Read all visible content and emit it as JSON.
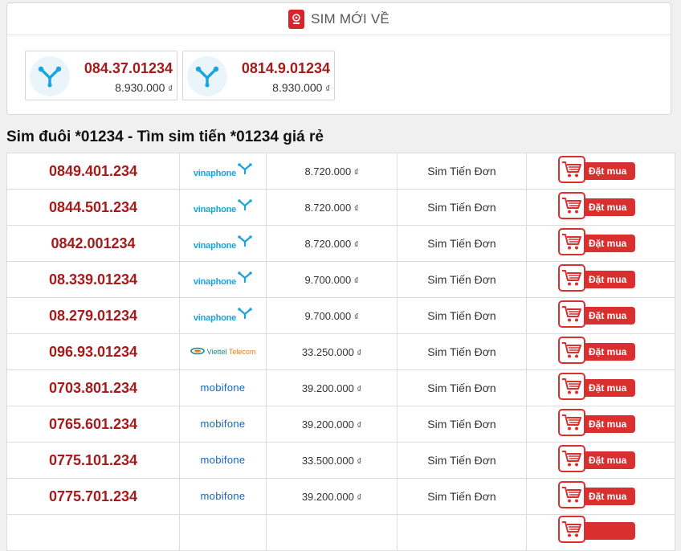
{
  "new_sims": {
    "title": "SIM MỚI VỀ",
    "cards": [
      {
        "number": "084.37.01234",
        "price": "8.930.000",
        "unit": "₫"
      },
      {
        "number": "0814.9.01234",
        "price": "8.930.000",
        "unit": "₫"
      }
    ]
  },
  "section_title": "Sim đuôi *01234 - Tìm sim tiến *01234 giá rẻ",
  "networks": {
    "vinaphone": "vinaphone",
    "viettel_a": "Viettel",
    "viettel_b": "Telecom",
    "mobifone": "mobifone"
  },
  "buy_label": "Đặt mua",
  "currency_unit": "₫",
  "rows": [
    {
      "number": "0849.401.234",
      "network": "vinaphone",
      "price": "8.720.000",
      "type": "Sim Tiến Đơn"
    },
    {
      "number": "0844.501.234",
      "network": "vinaphone",
      "price": "8.720.000",
      "type": "Sim Tiến Đơn"
    },
    {
      "number": "0842.001234",
      "network": "vinaphone",
      "price": "8.720.000",
      "type": "Sim Tiến Đơn"
    },
    {
      "number": "08.339.01234",
      "network": "vinaphone",
      "price": "9.700.000",
      "type": "Sim Tiến Đơn"
    },
    {
      "number": "08.279.01234",
      "network": "vinaphone",
      "price": "9.700.000",
      "type": "Sim Tiến Đơn"
    },
    {
      "number": "096.93.01234",
      "network": "viettel",
      "price": "33.250.000",
      "type": "Sim Tiến Đơn"
    },
    {
      "number": "0703.801.234",
      "network": "mobifone",
      "price": "39.200.000",
      "type": "Sim Tiến Đơn"
    },
    {
      "number": "0765.601.234",
      "network": "mobifone",
      "price": "39.200.000",
      "type": "Sim Tiến Đơn"
    },
    {
      "number": "0775.101.234",
      "network": "mobifone",
      "price": "33.500.000",
      "type": "Sim Tiến Đơn"
    },
    {
      "number": "0775.701.234",
      "network": "mobifone",
      "price": "39.200.000",
      "type": "Sim Tiến Đơn"
    }
  ],
  "colors": {
    "number_red": "#a51b1b",
    "button_red": "#d9302f",
    "vina_blue": "#1aa3dc",
    "mobi_blue": "#1464c0"
  }
}
